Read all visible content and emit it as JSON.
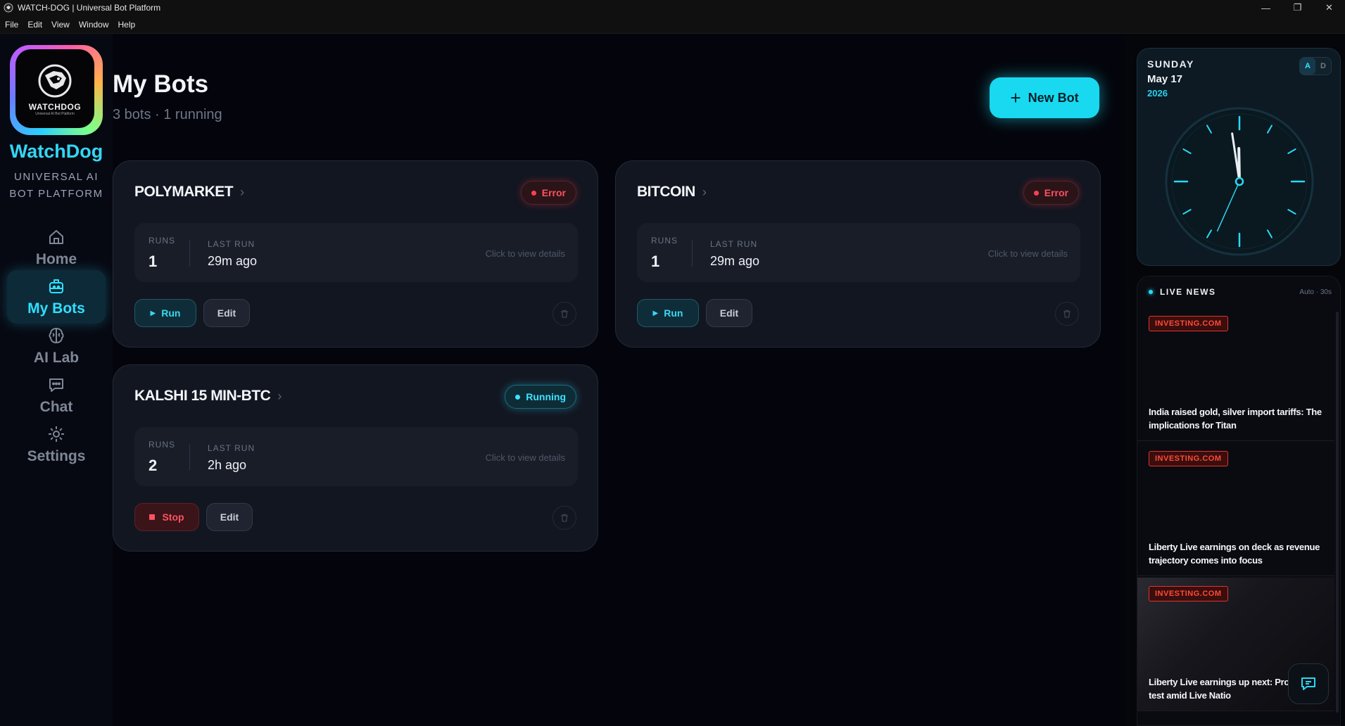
{
  "window": {
    "title": "WATCH-DOG | Universal Bot Platform",
    "controls": [
      "—",
      "❐",
      "✕"
    ]
  },
  "menu": [
    "File",
    "Edit",
    "View",
    "Window",
    "Help"
  ],
  "sidebar": {
    "logo_text": "WATCHDOG",
    "logo_sub": "Universal AI Bot Platform",
    "brand": "WatchDog",
    "tagline_1": "UNIVERSAL AI",
    "tagline_2": "BOT PLATFORM",
    "nav": [
      {
        "label": "Home",
        "icon": "home-icon",
        "active": false
      },
      {
        "label": "My Bots",
        "icon": "bot-icon",
        "active": true
      },
      {
        "label": "AI Lab",
        "icon": "brain-icon",
        "active": false
      },
      {
        "label": "Chat",
        "icon": "chat-icon",
        "active": false
      },
      {
        "label": "Settings",
        "icon": "gear-icon",
        "active": false
      }
    ]
  },
  "main": {
    "title": "My Bots",
    "subtitle": "3 bots · 1 running",
    "new_bot_label": "New Bot",
    "bots": [
      {
        "name": "POLYMARKET",
        "status": "Error",
        "runs_label": "RUNS",
        "runs": "1",
        "last_run_label": "LAST RUN",
        "last_run": "29m ago",
        "hint": "Click to view details",
        "primary_action": "Run",
        "edit_label": "Edit"
      },
      {
        "name": "BITCOIN",
        "status": "Error",
        "runs_label": "RUNS",
        "runs": "1",
        "last_run_label": "LAST RUN",
        "last_run": "29m ago",
        "hint": "Click to view details",
        "primary_action": "Run",
        "edit_label": "Edit"
      },
      {
        "name": "KALSHI 15 MIN-BTC",
        "status": "Running",
        "runs_label": "RUNS",
        "runs": "2",
        "last_run_label": "LAST RUN",
        "last_run": "2h ago",
        "hint": "Click to view details",
        "primary_action": "Stop",
        "edit_label": "Edit"
      }
    ]
  },
  "clock": {
    "day": "SUNDAY",
    "date": "May 17",
    "year": "2026",
    "toggle": [
      "A",
      "D"
    ],
    "time_hour": 11,
    "time_minute": 58,
    "time_second": 34
  },
  "news": {
    "header": "LIVE NEWS",
    "auto": "Auto · 30s",
    "items": [
      {
        "source": "INVESTING.COM",
        "headline": "India raised gold, silver import tariffs: The implications for Titan"
      },
      {
        "source": "INVESTING.COM",
        "headline": "Liberty Live earnings on deck as revenue trajectory comes into focus"
      },
      {
        "source": "INVESTING.COM",
        "headline": "Liberty Live earnings up next: Profitability test amid Live Natio"
      }
    ]
  },
  "colors": {
    "accent": "#19d9f0",
    "error": "#ff4050",
    "running": "#3ce2ff",
    "news_source": "#e0352e"
  }
}
